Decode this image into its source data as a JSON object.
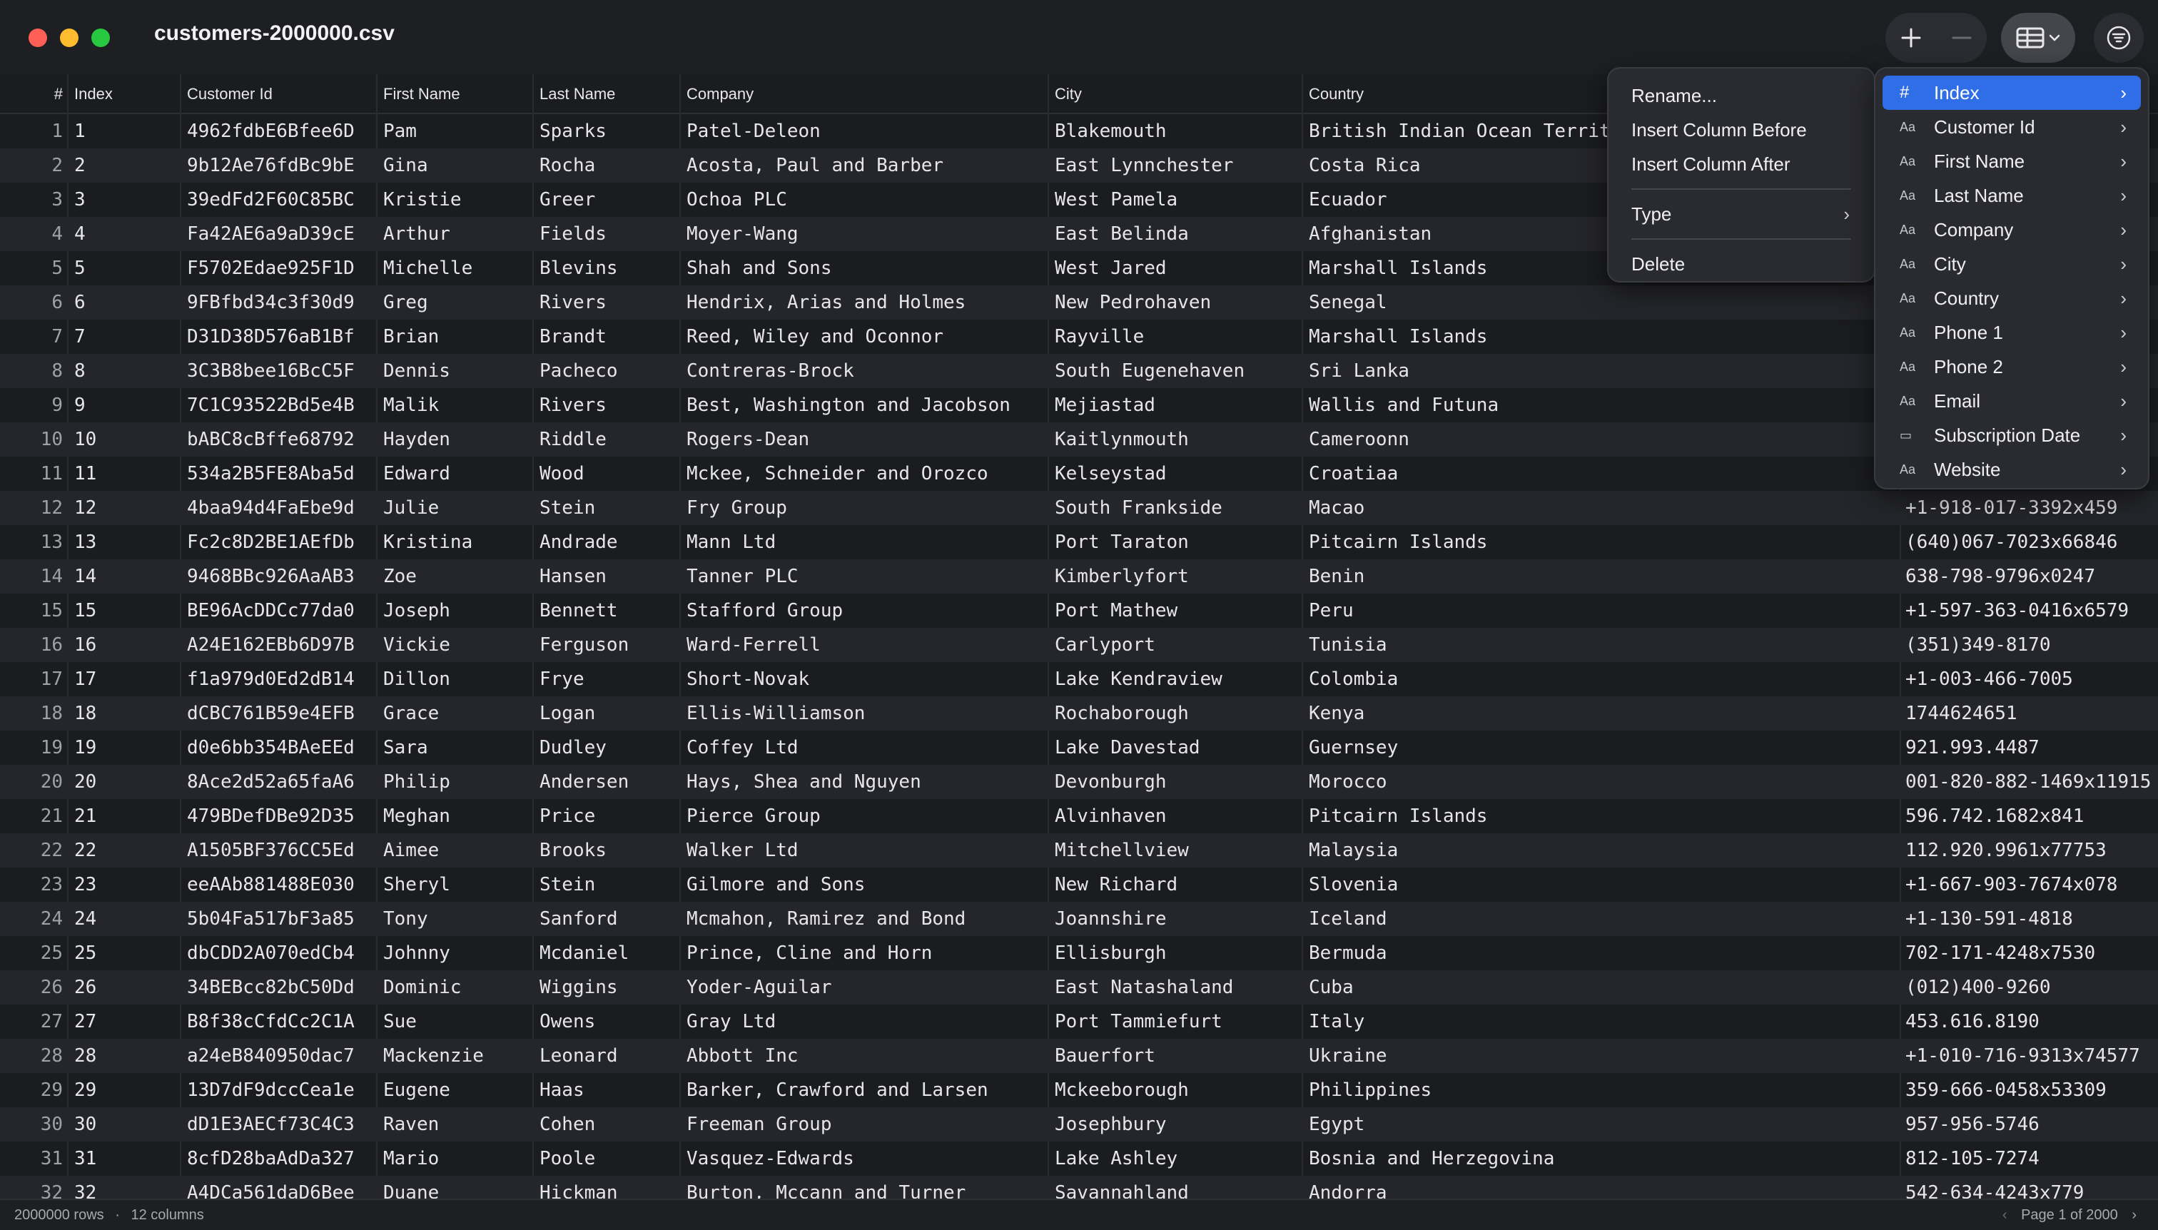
{
  "window": {
    "title": "customers-2000000.csv"
  },
  "headers": [
    "#",
    "Index",
    "Customer Id",
    "First Name",
    "Last Name",
    "Company",
    "City",
    "Country",
    "Phone 1"
  ],
  "rows": [
    [
      "1",
      "1",
      "4962fdbE6Bfee6D",
      "Pam",
      "Sparks",
      "Patel-Deleon",
      "Blakemouth",
      "British Indian Ocean Territ",
      ""
    ],
    [
      "2",
      "2",
      "9b12Ae76fdBc9bE",
      "Gina",
      "Rocha",
      "Acosta, Paul and Barber",
      "East Lynnchester",
      "Costa Rica",
      ""
    ],
    [
      "3",
      "3",
      "39edFd2F60C85BC",
      "Kristie",
      "Greer",
      "Ochoa PLC",
      "West Pamela",
      "Ecuador",
      ""
    ],
    [
      "4",
      "4",
      "Fa42AE6a9aD39cE",
      "Arthur",
      "Fields",
      "Moyer-Wang",
      "East Belinda",
      "Afghanistan",
      ""
    ],
    [
      "5",
      "5",
      "F5702Edae925F1D",
      "Michelle",
      "Blevins",
      "Shah and Sons",
      "West Jared",
      "Marshall Islands",
      ""
    ],
    [
      "6",
      "6",
      "9FBfbd34c3f30d9",
      "Greg",
      "Rivers",
      "Hendrix, Arias and Holmes",
      "New Pedrohaven",
      "Senegal",
      ""
    ],
    [
      "7",
      "7",
      "D31D38D576aB1Bf",
      "Brian",
      "Brandt",
      "Reed, Wiley and Oconnor",
      "Rayville",
      "Marshall Islands",
      ""
    ],
    [
      "8",
      "8",
      "3C3B8bee16BcC5F",
      "Dennis",
      "Pacheco",
      "Contreras-Brock",
      "South Eugenehaven",
      "Sri Lanka",
      ""
    ],
    [
      "9",
      "9",
      "7C1C93522Bd5e4B",
      "Malik",
      "Rivers",
      "Best, Washington and Jacobson",
      "Mejiastad",
      "Wallis and Futuna",
      ""
    ],
    [
      "10",
      "10",
      "bABC8cBffe68792",
      "Hayden",
      "Riddle",
      "Rogers-Dean",
      "Kaitlynmouth",
      "Cameroonn",
      ""
    ],
    [
      "11",
      "11",
      "534a2B5FE8Aba5d",
      "Edward",
      "Wood",
      "Mckee, Schneider and Orozco",
      "Kelseystad",
      "Croatiaa",
      ""
    ],
    [
      "12",
      "12",
      "4baa94d4FaEbe9d",
      "Julie",
      "Stein",
      "Fry Group",
      "South Frankside",
      "Macao",
      "+1-918-017-3392x459"
    ],
    [
      "13",
      "13",
      "Fc2c8D2BE1AEfDb",
      "Kristina",
      "Andrade",
      "Mann Ltd",
      "Port Taraton",
      "Pitcairn Islands",
      "(640)067-7023x66846"
    ],
    [
      "14",
      "14",
      "9468BBc926AaAB3",
      "Zoe",
      "Hansen",
      "Tanner PLC",
      "Kimberlyfort",
      "Benin",
      "638-798-9796x0247"
    ],
    [
      "15",
      "15",
      "BE96AcDDCc77da0",
      "Joseph",
      "Bennett",
      "Stafford Group",
      "Port Mathew",
      "Peru",
      "+1-597-363-0416x6579"
    ],
    [
      "16",
      "16",
      "A24E162EBb6D97B",
      "Vickie",
      "Ferguson",
      "Ward-Ferrell",
      "Carlyport",
      "Tunisia",
      "(351)349-8170"
    ],
    [
      "17",
      "17",
      "f1a979d0Ed2dB14",
      "Dillon",
      "Frye",
      "Short-Novak",
      "Lake Kendraview",
      "Colombia",
      "+1-003-466-7005"
    ],
    [
      "18",
      "18",
      "dCBC761B59e4EFB",
      "Grace",
      "Logan",
      "Ellis-Williamson",
      "Rochaborough",
      "Kenya",
      "1744624651"
    ],
    [
      "19",
      "19",
      "d0e6bb354BAeEEd",
      "Sara",
      "Dudley",
      "Coffey Ltd",
      "Lake Davestad",
      "Guernsey",
      "921.993.4487"
    ],
    [
      "20",
      "20",
      "8Ace2d52a65faA6",
      "Philip",
      "Andersen",
      "Hays, Shea and Nguyen",
      "Devonburgh",
      "Morocco",
      "001-820-882-1469x11915"
    ],
    [
      "21",
      "21",
      "479BDefDBe92D35",
      "Meghan",
      "Price",
      "Pierce Group",
      "Alvinhaven",
      "Pitcairn Islands",
      "596.742.1682x841"
    ],
    [
      "22",
      "22",
      "A1505BF376CC5Ed",
      "Aimee",
      "Brooks",
      "Walker Ltd",
      "Mitchellview",
      "Malaysia",
      "112.920.9961x77753"
    ],
    [
      "23",
      "23",
      "eeAAb881488E030",
      "Sheryl",
      "Stein",
      "Gilmore and Sons",
      "New Richard",
      "Slovenia",
      "+1-667-903-7674x078"
    ],
    [
      "24",
      "24",
      "5b04Fa517bF3a85",
      "Tony",
      "Sanford",
      "Mcmahon, Ramirez and Bond",
      "Joannshire",
      "Iceland",
      "+1-130-591-4818"
    ],
    [
      "25",
      "25",
      "dbCDD2A070edCb4",
      "Johnny",
      "Mcdaniel",
      "Prince, Cline and Horn",
      "Ellisburgh",
      "Bermuda",
      "702-171-4248x7530"
    ],
    [
      "26",
      "26",
      "34BEBcc82bC50Dd",
      "Dominic",
      "Wiggins",
      "Yoder-Aguilar",
      "East Natashaland",
      "Cuba",
      "(012)400-9260"
    ],
    [
      "27",
      "27",
      "B8f38cCfdCc2C1A",
      "Sue",
      "Owens",
      "Gray Ltd",
      "Port Tammiefurt",
      "Italy",
      "453.616.8190"
    ],
    [
      "28",
      "28",
      "a24eB840950dac7",
      "Mackenzie",
      "Leonard",
      "Abbott Inc",
      "Bauerfort",
      "Ukraine",
      "+1-010-716-9313x74577"
    ],
    [
      "29",
      "29",
      "13D7dF9dccCea1e",
      "Eugene",
      "Haas",
      "Barker, Crawford and Larsen",
      "Mckeeborough",
      "Philippines",
      "359-666-0458x53309"
    ],
    [
      "30",
      "30",
      "dD1E3AECf73C4C3",
      "Raven",
      "Cohen",
      "Freeman Group",
      "Josephbury",
      "Egypt",
      "957-956-5746"
    ],
    [
      "31",
      "31",
      "8cfD28baAdDa327",
      "Mario",
      "Poole",
      "Vasquez-Edwards",
      "Lake Ashley",
      "Bosnia and Herzegovina",
      "812-105-7274"
    ],
    [
      "32",
      "32",
      "A4DCa561daD6Bee",
      "Duane",
      "Hickman",
      "Burton, Mccann and Turner",
      "Savannahland",
      "Andorra",
      "542-634-4243x779"
    ]
  ],
  "status": {
    "rows": "2000000 rows",
    "separator": "·",
    "columns": "12 columns",
    "page": "Page 1 of 2000"
  },
  "context_menu": {
    "rename": "Rename...",
    "insert_before": "Insert Column Before",
    "insert_after": "Insert Column After",
    "type": "Type",
    "delete": "Delete"
  },
  "column_menu": [
    {
      "label": "Index",
      "icon": "#",
      "icon_name": "number-type-icon"
    },
    {
      "label": "Customer Id",
      "icon": "Aa",
      "icon_name": "text-type-icon"
    },
    {
      "label": "First Name",
      "icon": "Aa",
      "icon_name": "text-type-icon"
    },
    {
      "label": "Last Name",
      "icon": "Aa",
      "icon_name": "text-type-icon"
    },
    {
      "label": "Company",
      "icon": "Aa",
      "icon_name": "text-type-icon"
    },
    {
      "label": "City",
      "icon": "Aa",
      "icon_name": "text-type-icon"
    },
    {
      "label": "Country",
      "icon": "Aa",
      "icon_name": "text-type-icon"
    },
    {
      "label": "Phone 1",
      "icon": "Aa",
      "icon_name": "text-type-icon"
    },
    {
      "label": "Phone 2",
      "icon": "Aa",
      "icon_name": "text-type-icon"
    },
    {
      "label": "Email",
      "icon": "Aa",
      "icon_name": "text-type-icon"
    },
    {
      "label": "Subscription Date",
      "icon": "▭",
      "icon_name": "calendar-icon"
    },
    {
      "label": "Website",
      "icon": "Aa",
      "icon_name": "text-type-icon"
    }
  ],
  "colors": {
    "accent": "#2f6ee6",
    "close": "#ff5f57",
    "minimize": "#febc2e",
    "maximize": "#28c840"
  }
}
